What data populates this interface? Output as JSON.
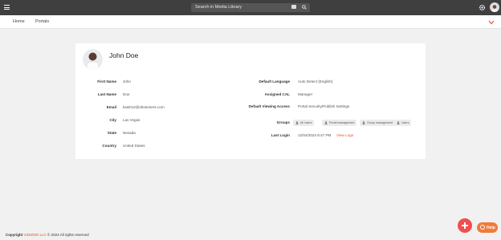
{
  "topbar": {
    "search_placeholder": "Search in Media Library",
    "icons": [
      "hamburger-icon",
      "chat-icon",
      "search-icon",
      "gear-icon",
      "avatar"
    ]
  },
  "navbar": {
    "items": [
      "Home",
      "Portals"
    ]
  },
  "profile": {
    "name": "John Doe",
    "left_fields": [
      {
        "label": "First Name",
        "value": "John"
      },
      {
        "label": "Last Name",
        "value": "Doe"
      },
      {
        "label": "Email",
        "value": "kasi012@vbrainsers.com"
      },
      {
        "label": "City",
        "value": "Las Vegas"
      },
      {
        "label": "State",
        "value": "Nevada"
      },
      {
        "label": "Country",
        "value": "United States"
      }
    ],
    "right_fields": [
      {
        "label": "Default Language",
        "value": "Auto Detect (English)"
      },
      {
        "label": "Assigned CAL",
        "value": "Manager"
      },
      {
        "label": "Default Viewing Access",
        "value": "Portal Security/Publish Settings"
      },
      {
        "label": "Groups",
        "value": ""
      },
      {
        "label": "Last Login",
        "value": "12/04/2024 8:47 PM"
      }
    ],
    "groups": [
      "All Users",
      "Portal management",
      "Group management",
      "Users"
    ],
    "view_logs_label": "View Logs"
  },
  "footer": {
    "prefix": "Copyright",
    "brand": "VIDIZMO LLC",
    "suffix": "© 2024 All rights reserved"
  },
  "help_label": "Help",
  "colors": {
    "topbar": "#3f3f3f",
    "accent": "#e0552e",
    "fab": "#ef4f4f",
    "help": "#ee7b3a"
  }
}
